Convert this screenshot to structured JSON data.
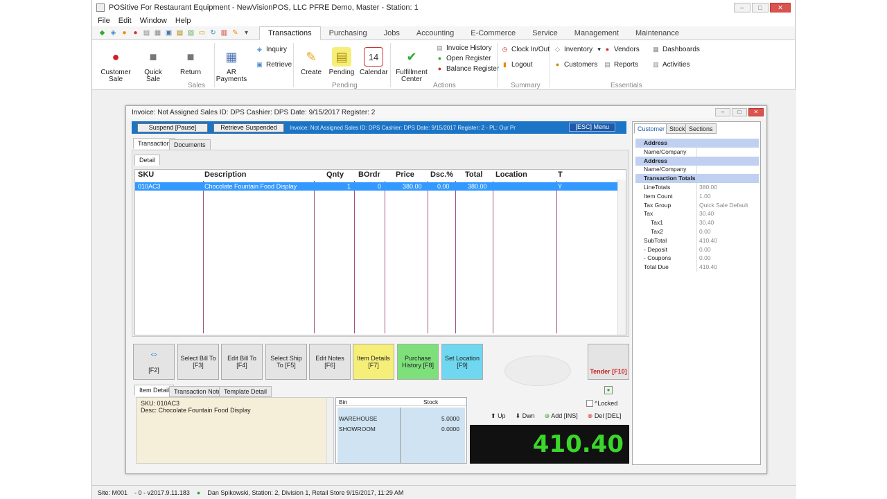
{
  "title": "POSitive For Restaurant Equipment - NewVisionPOS, LLC PFRE Demo, Master - Station: 1",
  "menu": [
    "File",
    "Edit",
    "Window",
    "Help"
  ],
  "ribbon_tabs": [
    "Transactions",
    "Purchasing",
    "Jobs",
    "Accounting",
    "E-Commerce",
    "Service",
    "Management",
    "Maintenance"
  ],
  "ribbon": {
    "customer_sale": "Customer Sale",
    "quick_sale": "Quick Sale",
    "return": "Return",
    "sales_group": "Sales",
    "ar_payments": "AR Payments",
    "inquiry": "Inquiry",
    "retrieve": "Retrieve",
    "create": "Create",
    "pending": "Pending",
    "calendar": "Calendar",
    "calendar_day": "14",
    "pending_group": "Pending",
    "fulfillment_center": "Fulfillment Center",
    "invoice_history": "Invoice History",
    "open_register": "Open Register",
    "balance_register": "Balance Register",
    "actions_group": "Actions",
    "clock_in_out": "Clock In/Out",
    "logout": "Logout",
    "summary_group": "Summary",
    "inventory": "Inventory",
    "customers": "Customers",
    "vendors": "Vendors",
    "reports": "Reports",
    "dashboards": "Dashboards",
    "activities": "Activities",
    "essentials_group": "Essentials"
  },
  "invoice": {
    "title": "Invoice: Not Assigned  Sales ID: DPS  Cashier: DPS  Date: 9/15/2017  Register: 2",
    "suspend": "Suspend [Pause]",
    "retrieve_suspended": "Retrieve Suspended",
    "info": "Invoice: Not Assigned  Sales ID: DPS  Cashier: DPS  Date: 9/15/2017  Register: 2 - PL: Our Pr",
    "esc_menu": "[ESC] Menu",
    "tab_transaction": "Transaction",
    "tab_documents": "Documents",
    "tab_detail": "Detail"
  },
  "grid": {
    "headers": [
      "SKU",
      "Description",
      "Qnty",
      "BOrdr",
      "Price",
      "Dsc.%",
      "Total",
      "Location",
      "T"
    ],
    "rows": [
      {
        "sku": "010AC3",
        "desc": "Chocolate Fountain Food Display",
        "qnty": "1",
        "bordr": "0",
        "price": "380.00",
        "dsc": "0.00",
        "total": "380.00",
        "location": "",
        "t": "Y"
      }
    ]
  },
  "buttons": {
    "f2_arrow": "⇔",
    "f2": "[F2]",
    "select_bill_to": "Select Bill To [F3]",
    "edit_bill_to": "Edit Bill To [F4]",
    "select_ship_to": "Select Ship To [F5]",
    "edit_notes": "Edit Notes [F6]",
    "item_details": "Item Details [F7]",
    "purchase_history": "Purchase History [F8]",
    "set_location": "Set Location [F9]",
    "tender": "Tender [F10]"
  },
  "bottom_tabs": [
    "Item Detail",
    "Transaction Note",
    "Template Detail"
  ],
  "item_detail": {
    "sku": "SKU: 010AC3",
    "desc": "Desc: Chocolate Fountain Food Display"
  },
  "stock": {
    "headers": [
      "Bin",
      "Stock"
    ],
    "rows": [
      {
        "bin": "WAREHOUSE",
        "stock": "5.0000"
      },
      {
        "bin": "SHOWROOM",
        "stock": "0.0000"
      }
    ]
  },
  "controls": {
    "locked": "^Locked",
    "up": "Up",
    "down": "Dwn",
    "add": "Add [INS]",
    "del": "Del [DEL]"
  },
  "total_due_display": "410.40",
  "panel": {
    "tabs": [
      "Customer",
      "Stock",
      "Sections"
    ],
    "rows": [
      {
        "k": "Address",
        "v": "",
        "hd": true
      },
      {
        "k": "Name/Company",
        "v": ""
      },
      {
        "k": "Address",
        "v": "",
        "hd": true
      },
      {
        "k": "Name/Company",
        "v": ""
      },
      {
        "k": "Transaction Totals",
        "v": "",
        "hd": true
      },
      {
        "k": "LineTotals",
        "v": "380.00"
      },
      {
        "k": "Item Count",
        "v": "1.00"
      },
      {
        "k": "Tax Group",
        "v": "Quick Sale Default"
      },
      {
        "k": "Tax",
        "v": "30.40"
      },
      {
        "k": "Tax1",
        "v": "30.40",
        "indent": true
      },
      {
        "k": "Tax2",
        "v": "0.00",
        "indent": true
      },
      {
        "k": "SubTotal",
        "v": "410.40"
      },
      {
        "k": "- Deposit",
        "v": "0.00"
      },
      {
        "k": "- Coupons",
        "v": "0.00"
      },
      {
        "k": "Total Due",
        "v": "410.40"
      }
    ]
  },
  "status": {
    "site": "Site: M001",
    "ver": "- 0 - v2017.9.11.183",
    "user": "Dan Spikowski, Station: 2, Division 1, Retail Store  9/15/2017, 11:29 AM"
  },
  "colors": {
    "selected_row": "#3399ff",
    "blue_bar": "#1b74c5",
    "total_text": "#3bd62a",
    "item_details_btn": "#f5ef7a",
    "purchase_history_btn": "#7de07a",
    "set_location_btn": "#6fd8f0"
  }
}
